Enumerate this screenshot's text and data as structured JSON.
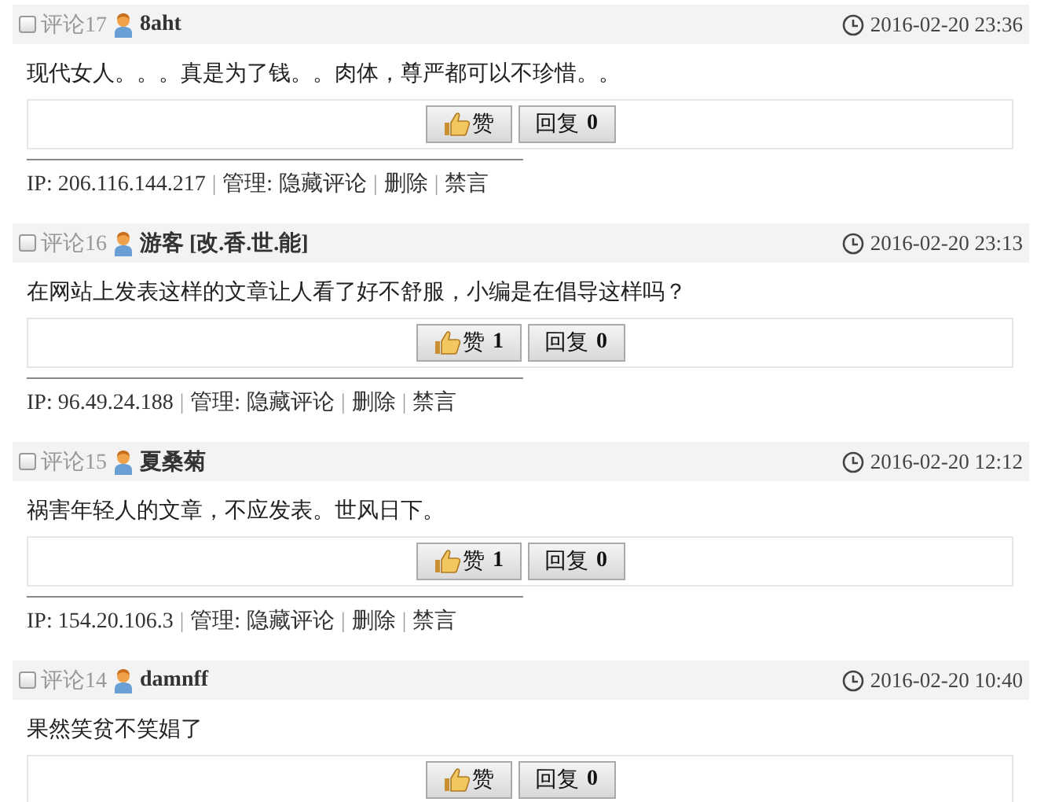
{
  "comments": [
    {
      "checked": false,
      "label": "评论17",
      "user": "8aht",
      "time": "2016-02-20 23:36",
      "text": "现代女人。。。真是为了钱。。肉体，尊严都可以不珍惜。。",
      "like": {
        "label": "赞"
      },
      "reply": {
        "label": "回复",
        "count": "0"
      },
      "admin": {
        "ip": "IP: 206.116.144.217",
        "sep": "|",
        "manage": "管理:",
        "links": [
          "隐藏评论",
          "删除",
          "禁言"
        ]
      }
    },
    {
      "checked": false,
      "label": "评论16",
      "user": "游客 [改.香.世.能]",
      "time": "2016-02-20 23:13",
      "text": "在网站上发表这样的文章让人看了好不舒服，小编是在倡导这样吗？",
      "like": {
        "label": "赞",
        "count": "1"
      },
      "reply": {
        "label": "回复",
        "count": "0"
      },
      "admin": {
        "ip": "IP: 96.49.24.188",
        "sep": "|",
        "manage": "管理:",
        "links": [
          "隐藏评论",
          "删除",
          "禁言"
        ]
      }
    },
    {
      "checked": false,
      "label": "评论15",
      "user": "夏桑菊",
      "time": "2016-02-20 12:12",
      "text": "祸害年轻人的文章，不应发表。世风日下。",
      "like": {
        "label": "赞",
        "count": "1"
      },
      "reply": {
        "label": "回复",
        "count": "0"
      },
      "admin": {
        "ip": "IP: 154.20.106.3",
        "sep": "|",
        "manage": "管理:",
        "links": [
          "隐藏评论",
          "删除",
          "禁言"
        ]
      }
    },
    {
      "checked": false,
      "label": "评论14",
      "user": "damnff",
      "time": "2016-02-20 10:40",
      "text": "果然笑贫不笑娼了",
      "like": {
        "label": "赞"
      },
      "reply": {
        "label": "回复",
        "count": "0"
      }
    }
  ]
}
